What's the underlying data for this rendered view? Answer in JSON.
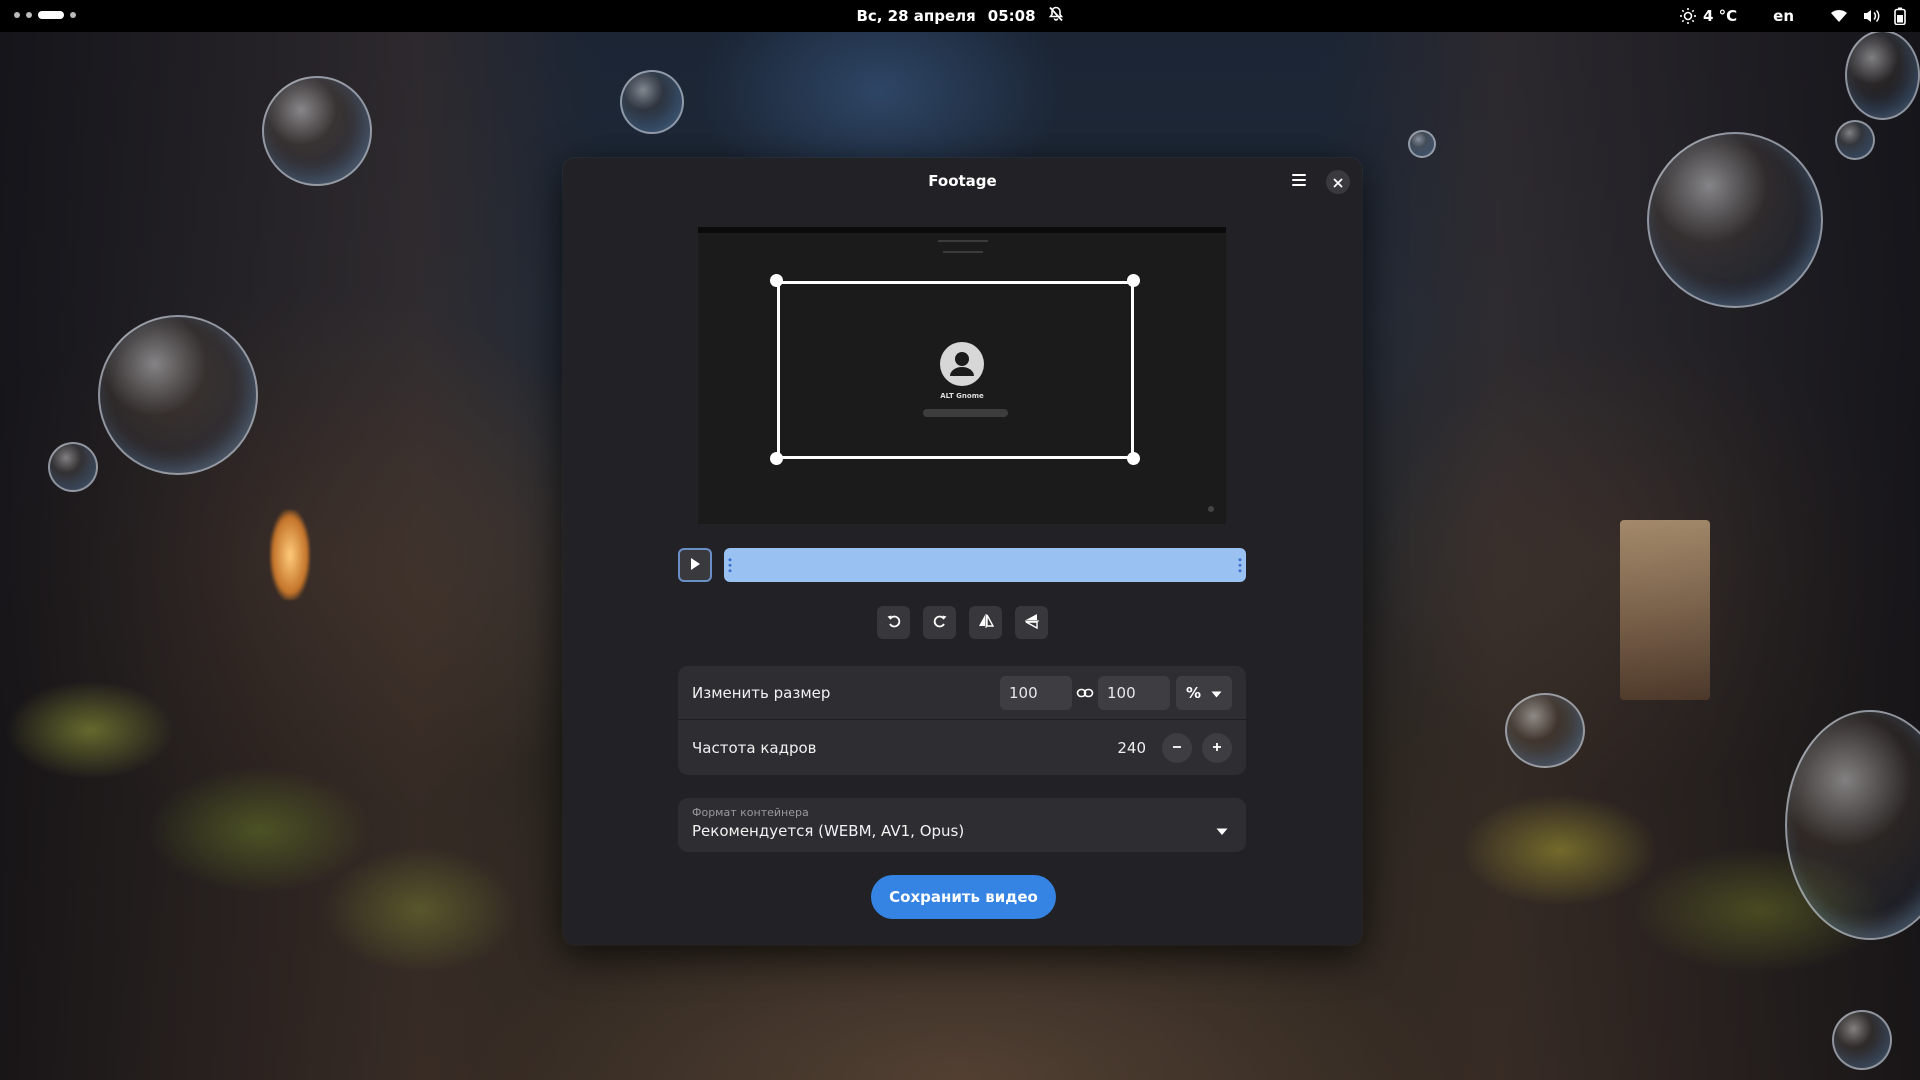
{
  "topbar": {
    "date": "Вс, 28 апреля",
    "time": "05:08",
    "temperature": "4 °C",
    "keyboard_layout": "en",
    "icons": [
      "bell-off-icon",
      "weather-icon",
      "wifi-icon",
      "volume-icon",
      "battery-icon"
    ]
  },
  "window": {
    "title": "Footage"
  },
  "preview": {
    "username": "ALT Gnome"
  },
  "resize": {
    "label": "Изменить размер",
    "width": "100",
    "height": "100",
    "unit": "%"
  },
  "framerate": {
    "label": "Частота кадров",
    "value": "240"
  },
  "container": {
    "label": "Формат контейнера",
    "value": "Рекомендуется (WEBM, AV1, Opus)"
  },
  "save_label": "Сохранить видео",
  "colors": {
    "accent": "#3584e4",
    "timeline": "#99c1f1",
    "window_bg": "#222226",
    "card_bg": "#2e2e32"
  }
}
